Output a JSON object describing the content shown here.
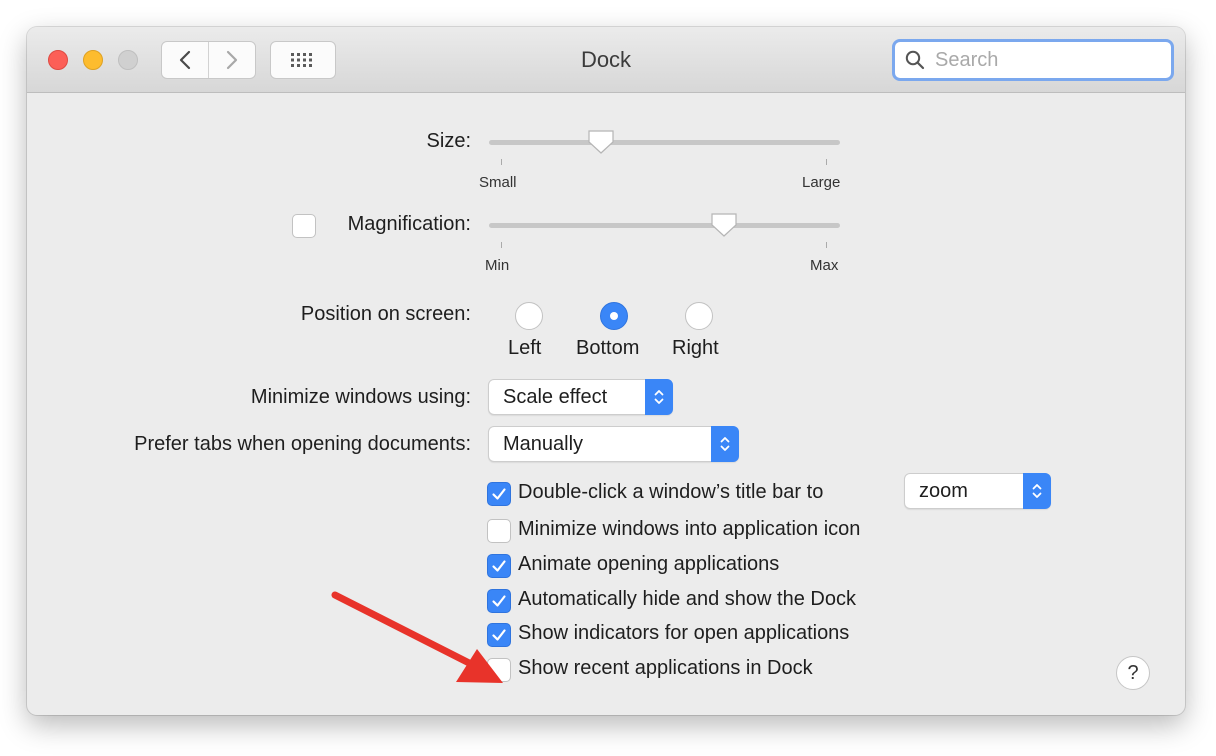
{
  "window": {
    "title": "Dock"
  },
  "toolbar": {
    "back_icon": "chevron-left-icon",
    "forward_icon": "chevron-right-icon",
    "grid_icon": "show-all-grid-icon"
  },
  "search": {
    "placeholder": "Search",
    "value": ""
  },
  "size": {
    "label": "Size:",
    "min_label": "Small",
    "max_label": "Large",
    "level": 0.32
  },
  "magnification": {
    "label": "Magnification:",
    "checked": false,
    "min_label": "Min",
    "max_label": "Max",
    "level": 0.67
  },
  "position": {
    "label": "Position on screen:",
    "options": [
      "Left",
      "Bottom",
      "Right"
    ],
    "selected": "Bottom"
  },
  "minimize_using": {
    "label": "Minimize windows using:",
    "value": "Scale effect"
  },
  "prefer_tabs": {
    "label": "Prefer tabs when opening documents:",
    "value": "Manually"
  },
  "double_click": {
    "label": "Double-click a window’s title bar to",
    "checked": true,
    "value": "zoom"
  },
  "checkboxes": [
    {
      "label": "Minimize windows into application icon",
      "checked": false
    },
    {
      "label": "Animate opening applications",
      "checked": true
    },
    {
      "label": "Automatically hide and show the Dock",
      "checked": true
    },
    {
      "label": "Show indicators for open applications",
      "checked": true
    },
    {
      "label": "Show recent applications in Dock",
      "checked": false
    }
  ],
  "help": {
    "label": "?"
  },
  "colors": {
    "accent": "#3a86f7",
    "annotation_arrow": "#e8332a",
    "close": "#fc5f57",
    "minimize": "#fdbc2e",
    "zoom_disabled": "#d0d0d0"
  }
}
